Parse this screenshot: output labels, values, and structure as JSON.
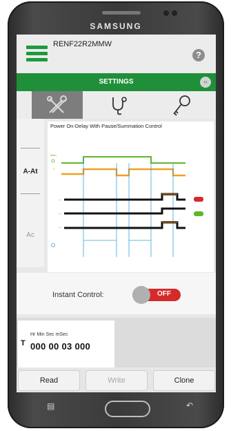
{
  "device": {
    "brand": "SAMSUNG"
  },
  "header": {
    "device_name": "RENF22R2MMW",
    "help_icon": "question-icon"
  },
  "settings_bar": {
    "label": "SETTINGS",
    "expand_icon": "arrows-icon"
  },
  "tools": [
    {
      "icon": "tools-icon",
      "active": true
    },
    {
      "icon": "stethoscope-icon",
      "active": false
    },
    {
      "icon": "key-icon",
      "active": false
    }
  ],
  "function_tabs": [
    {
      "label": "A-At",
      "selected": true
    },
    {
      "label": "Ac",
      "selected": false
    }
  ],
  "diagram": {
    "title": "Power On-Delay With Pause/Summation Control",
    "colors": {
      "green": "#5fb62a",
      "orange": "#f0a020",
      "black": "#111111",
      "blue": "#3aa0d8",
      "red": "#d42a2a"
    }
  },
  "instant_control": {
    "label": "Instant Control:",
    "state": "OFF"
  },
  "timer": {
    "letter": "T",
    "units_label": "Hr  Min  Sec mSec",
    "value": "000 00 03 000"
  },
  "buttons": {
    "read": "Read",
    "write": "Write",
    "clone": "Clone"
  },
  "nav_icons": {
    "recent": "recent-apps-icon",
    "home": "home-button",
    "back": "back-icon"
  }
}
